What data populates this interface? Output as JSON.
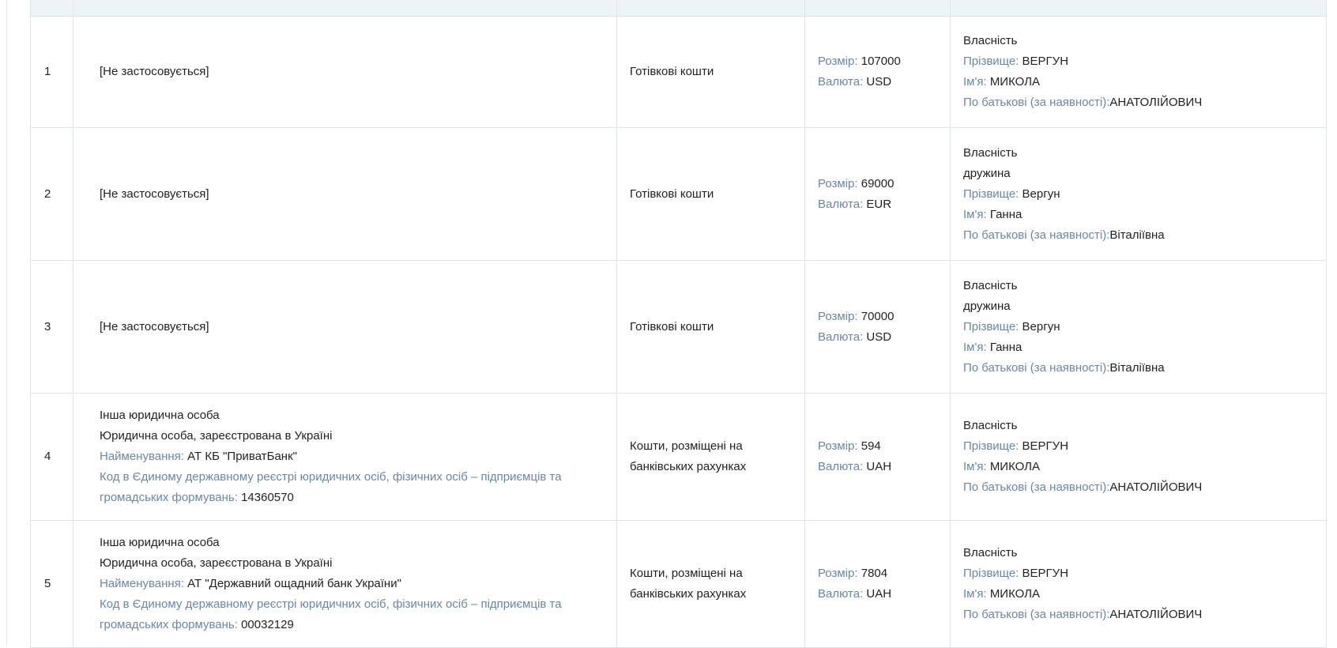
{
  "labels": {
    "size": "Розмір:",
    "currency": "Валюта:",
    "surname": "Прізвище:",
    "name": "Ім'я:",
    "patronymic": "По батькові (за наявності):",
    "company_name": "Найменування:",
    "edrpou": "Код в Єдиному державному реєстрі юридичних осіб, фізичних осіб – підприємців та громадських формувань:"
  },
  "colors": {
    "label": "#6b86a6",
    "text": "#222222",
    "border": "#dfe4ea",
    "header_bg": "#eef3f7"
  },
  "rows": [
    {
      "num": "1",
      "source": "[Не застосовується]",
      "type": "Готівкові кошти",
      "size": "107000",
      "currency": "USD",
      "ownership": "Власність",
      "relation": "",
      "surname": "ВЕРГУН",
      "name": "МИКОЛА",
      "patronymic": "АНАТОЛІЙОВИЧ"
    },
    {
      "num": "2",
      "source": "[Не застосовується]",
      "type": "Готівкові кошти",
      "size": "69000",
      "currency": "EUR",
      "ownership": "Власність",
      "relation": "дружина",
      "surname": "Вергун",
      "name": "Ганна",
      "patronymic": "Віталіївна"
    },
    {
      "num": "3",
      "source": "[Не застосовується]",
      "type": "Готівкові кошти",
      "size": "70000",
      "currency": "USD",
      "ownership": "Власність",
      "relation": "дружина",
      "surname": "Вергун",
      "name": "Ганна",
      "patronymic": "Віталіївна"
    },
    {
      "num": "4",
      "source_type": "Інша юридична особа",
      "source_reg": "Юридична особа, зареєстрована в Україні",
      "company_name": "АТ КБ \"ПриватБанк\"",
      "edrpou": "14360570",
      "type": "Кошти, розміщені на банківських рахунках",
      "size": "594",
      "currency": "UAH",
      "ownership": "Власність",
      "surname": "ВЕРГУН",
      "name": "МИКОЛА",
      "patronymic": "АНАТОЛІЙОВИЧ"
    },
    {
      "num": "5",
      "source_type": "Інша юридична особа",
      "source_reg": "Юридична особа, зареєстрована в Україні",
      "company_name": "АТ \"Державний ощадний банк України\"",
      "edrpou": "00032129",
      "type": "Кошти, розміщені на банківських рахунках",
      "size": "7804",
      "currency": "UAH",
      "ownership": "Власність",
      "surname": "ВЕРГУН",
      "name": "МИКОЛА",
      "patronymic": "АНАТОЛІЙОВИЧ"
    }
  ]
}
